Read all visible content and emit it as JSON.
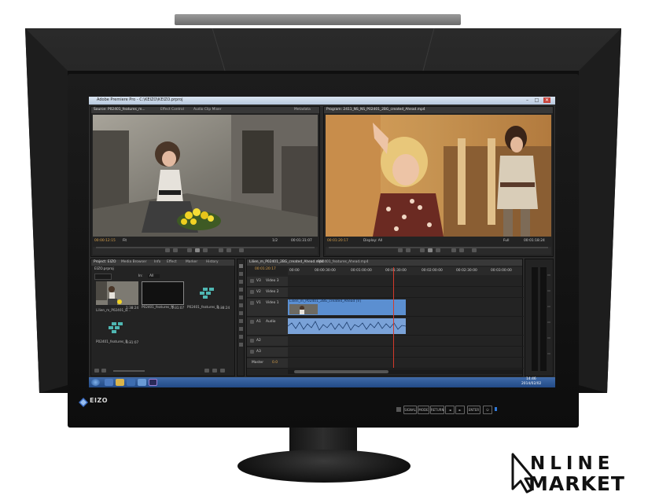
{
  "window": {
    "title": "Adobe Premiere Pro - C:\\KEIZO\\KEIZO.prproj",
    "controls": [
      "–",
      "□",
      "✕"
    ]
  },
  "source_monitor": {
    "tabs": [
      "Source: P02401_features_m...",
      "Effect Control",
      "Audio Clip Mixer",
      "Metadata"
    ],
    "timecode_in": "00:00:12:15",
    "timecode_out": "00:01:31:07",
    "fit_label": "Fit",
    "scale_label": "1/2"
  },
  "program_monitor": {
    "tabs": [
      "Program: 2411_NS_NS_P02401_2BG_created_Ahead.mp4"
    ],
    "timecode_in": "00:01:20:17",
    "timecode_out": "00:01:18:24",
    "fit_label": "Display: All",
    "scale_label": "Full"
  },
  "project_panel": {
    "tabs": [
      "Project: EIZO",
      "Media Browser",
      "Info",
      "Effect",
      "Marker",
      "History"
    ],
    "subtitle": "EIZO.prproj",
    "in_label": "In:",
    "in_value": "All",
    "items": [
      {
        "name": "Lilien_m_P02401_B...",
        "duration": "1:38:24",
        "kind": "image"
      },
      {
        "name": "P02401_features_M...",
        "duration": "1:31:07",
        "kind": "black"
      },
      {
        "name": "P02401_features_B...",
        "duration": "1:38:24",
        "kind": "sequence"
      },
      {
        "name": "P02401_features_B...",
        "duration": "1:31:07",
        "kind": "sequence"
      }
    ]
  },
  "timeline": {
    "tabs": [
      "Lilien_m_P02401_2BG_created_Ahead.mp4",
      "P02401_features_Ahead.mp4"
    ],
    "timecode": "00:01:20:17",
    "ruler": [
      "00:00",
      "00:00:30:00",
      "00:01:00:00",
      "00:01:30:00",
      "00:02:00:00",
      "00:02:30:00",
      "00:03:00:00"
    ],
    "tracks": [
      "V3",
      "Video 3",
      "V2",
      "Video 2",
      "V1",
      "Video 1",
      "A1",
      "Audio",
      "A2",
      "A3",
      "Master"
    ],
    "master_value": "0.0",
    "clip_label": "Lilien_m_P02401_2BG_created_Ahead [V]"
  },
  "taskbar": {
    "time": "14:46",
    "date": "2014/02/02"
  },
  "monitor": {
    "brand": "EIZO",
    "buttons": [
      "SIGNAL",
      "MODE",
      "RETURN",
      "◄",
      "►",
      "ENTER",
      "⏻"
    ]
  },
  "watermark": {
    "line1": "NLINE",
    "line2": "MARKET",
    "colors": {
      "ink": "#111111"
    }
  },
  "colors": {
    "accent_timecode": "#d9a14a",
    "clip_video": "#5b8fd1",
    "clip_audio": "#7aa2d8",
    "playhead": "#d33a2b",
    "taskbar": "#2d579a"
  },
  "icons": [
    "minimize-icon",
    "maximize-icon",
    "close-icon",
    "play-icon",
    "step-back-icon",
    "step-forward-icon",
    "windows-start-icon",
    "premiere-app-icon",
    "power-icon",
    "cursor-icon"
  ]
}
